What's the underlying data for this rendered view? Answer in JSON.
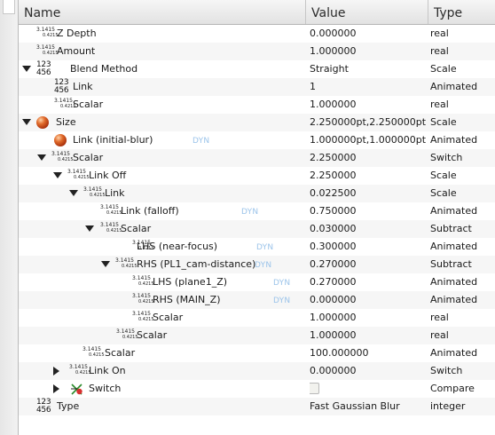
{
  "header": {
    "name": "Name",
    "value": "Value",
    "type": "Type"
  },
  "rows": [
    {
      "name": "Z Depth",
      "value": "0.000000",
      "type": "real",
      "icon": "real"
    },
    {
      "name": "Amount",
      "value": "1.000000",
      "type": "real",
      "icon": "real"
    },
    {
      "name": "Blend Method",
      "value": "Straight",
      "type": "Scale",
      "icon": "integer",
      "expander": "open"
    },
    {
      "name": "Link",
      "value": "1",
      "type": "Animated",
      "icon": "integer"
    },
    {
      "name": "Scalar",
      "value": "1.000000",
      "type": "real",
      "icon": "real"
    },
    {
      "name": "Size",
      "value": "2.250000pt,2.250000pt",
      "type": "Scale",
      "icon": "vector-ball",
      "expander": "open"
    },
    {
      "name": "Link (initial-blur)",
      "value": "1.000000pt,1.000000pt",
      "type": "Animated",
      "icon": "vector-ball",
      "dyn": "DYN"
    },
    {
      "name": "Scalar",
      "value": "2.250000",
      "type": "Switch",
      "icon": "real",
      "expander": "open"
    },
    {
      "name": "Link Off",
      "value": "2.250000",
      "type": "Scale",
      "icon": "real",
      "expander": "open"
    },
    {
      "name": "Link",
      "value": "0.022500",
      "type": "Scale",
      "icon": "real",
      "expander": "open"
    },
    {
      "name": "Link (falloff)",
      "value": "0.750000",
      "type": "Animated",
      "icon": "real",
      "dyn": "DYN"
    },
    {
      "name": "Scalar",
      "value": "0.030000",
      "type": "Subtract",
      "icon": "real",
      "expander": "open"
    },
    {
      "name": "LHS (near-focus)",
      "value": "0.300000",
      "type": "Animated",
      "icon": "real",
      "dyn": "DYN"
    },
    {
      "name": "RHS (PL1_cam-distance)",
      "value": "0.270000",
      "type": "Subtract",
      "icon": "real",
      "expander": "open",
      "dyn": "DYN"
    },
    {
      "name": "LHS (plane1_Z)",
      "value": "0.270000",
      "type": "Animated",
      "icon": "real",
      "dyn": "DYN"
    },
    {
      "name": "RHS (MAIN_Z)",
      "value": "0.000000",
      "type": "Animated",
      "icon": "real",
      "dyn": "DYN"
    },
    {
      "name": "Scalar",
      "value": "1.000000",
      "type": "real",
      "icon": "real"
    },
    {
      "name": "Scalar",
      "value": "1.000000",
      "type": "real",
      "icon": "real"
    },
    {
      "name": "Scalar",
      "value": "100.000000",
      "type": "Animated",
      "icon": "real"
    },
    {
      "name": "Link On",
      "value": "0.000000",
      "type": "Switch",
      "icon": "real",
      "expander": "closed"
    },
    {
      "name": "Switch",
      "value": "",
      "type": "Compare",
      "icon": "bool-compare",
      "expander": "closed",
      "checkbox": true
    },
    {
      "name": "Type",
      "value": "Fast Gaussian Blur",
      "type": "integer",
      "icon": "integer"
    }
  ],
  "icon_glyphs": {
    "real": {
      "top": "3.1415",
      "bottom": "0.4215"
    },
    "integer": {
      "top": "123",
      "bottom": "456"
    }
  }
}
